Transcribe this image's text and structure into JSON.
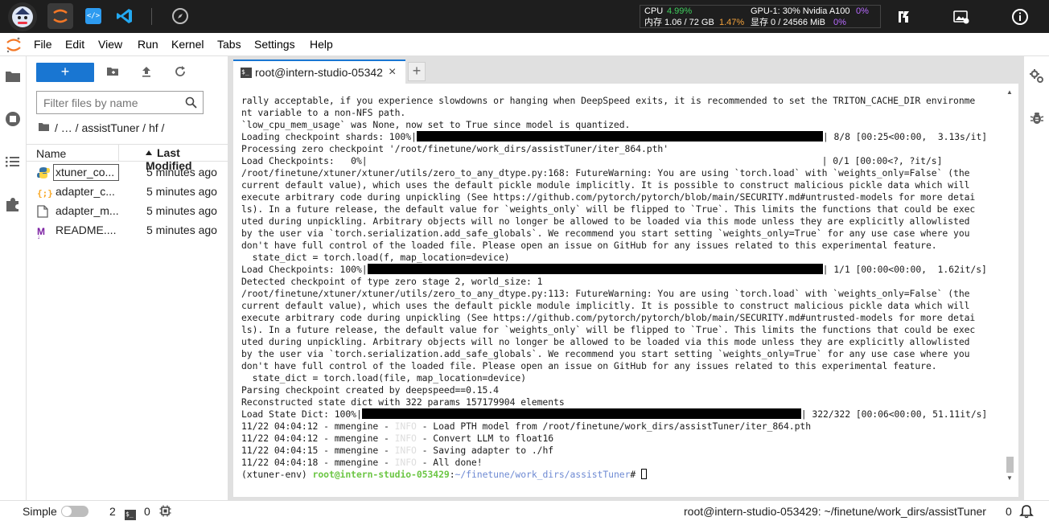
{
  "topbar": {
    "icons": [
      "avatar-logo",
      "jupyter-icon",
      "code-icon",
      "vscode-icon",
      "compass-icon"
    ],
    "cpu_label": "CPU",
    "cpu_value": "4.99%",
    "mem_label": "内存 1.06 / 72 GB",
    "mem_value": "1.47%",
    "gpu_label": "GPU-1: 30% Nvidia A100",
    "gpu_value": "0%",
    "vram_label": "显存 0 / 24566 MiB",
    "vram_value": "0%",
    "right_icons": [
      "transfer-icon",
      "image-settings-icon",
      "info-icon"
    ],
    "colors": {
      "green": "#3fce5d",
      "orange": "#f3a23c",
      "purple": "#b86bff"
    }
  },
  "menu": {
    "items": [
      "File",
      "Edit",
      "View",
      "Run",
      "Kernel",
      "Tabs",
      "Settings",
      "Help"
    ]
  },
  "filebrowser": {
    "new_label": "+",
    "filter_placeholder": "Filter files by name",
    "breadcrumb": "/ … / assistTuner / hf /",
    "col_name": "Name",
    "col_modified": "Last Modified",
    "files": [
      {
        "name": "xtuner_co...",
        "time": "5 minutes ago",
        "icon": "python-icon"
      },
      {
        "name": "adapter_c...",
        "time": "5 minutes ago",
        "icon": "json-icon"
      },
      {
        "name": "adapter_m...",
        "time": "5 minutes ago",
        "icon": "file-icon"
      },
      {
        "name": "README....",
        "time": "5 minutes ago",
        "icon": "markdown-icon"
      }
    ]
  },
  "tab": {
    "label": "root@intern-studio-05342",
    "close": "×",
    "add": "+"
  },
  "terminal": {
    "lines": [
      "rally acceptable, if you experience slowdowns or hanging when DeepSpeed exits, it is recommended to set the TRITON_CACHE_DIR environme",
      "nt variable to a non-NFS path.",
      "`low_cpu_mem_usage` was None, now set to True since model is quantized.",
      "Loading checkpoint shards: 100%|",
      "| 8/8 [00:25<00:00,  3.13s/it]",
      "Processing zero checkpoint '/root/finetune/work_dirs/assistTuner/iter_864.pth'",
      "Load Checkpoints:   0%|                                                                                   | 0/1 [00:00<?, ?it/s]",
      "/root/finetune/xtuner/xtuner/utils/zero_to_any_dtype.py:168: FutureWarning: You are using `torch.load` with `weights_only=False` (the",
      "current default value), which uses the default pickle module implicitly. It is possible to construct malicious pickle data which will",
      "execute arbitrary code during unpickling (See https://github.com/pytorch/pytorch/blob/main/SECURITY.md#untrusted-models for more detai",
      "ls). In a future release, the default value for `weights_only` will be flipped to `True`. This limits the functions that could be exec",
      "uted during unpickling. Arbitrary objects will no longer be allowed to be loaded via this mode unless they are explicitly allowlisted",
      "by the user via `torch.serialization.add_safe_globals`. We recommend you start setting `weights_only=True` for any use case where you",
      "don't have full control of the loaded file. Please open an issue on GitHub for any issues related to this experimental feature.",
      "  state_dict = torch.load(f, map_location=device)",
      "Load Checkpoints: 100%|",
      "| 1/1 [00:00<00:00,  1.62it/s]",
      "Detected checkpoint of type zero stage 2, world_size: 1",
      "/root/finetune/xtuner/xtuner/utils/zero_to_any_dtype.py:113: FutureWarning: You are using `torch.load` with `weights_only=False` (the",
      "current default value), which uses the default pickle module implicitly. It is possible to construct malicious pickle data which will",
      "execute arbitrary code during unpickling (See https://github.com/pytorch/pytorch/blob/main/SECURITY.md#untrusted-models for more detai",
      "ls). In a future release, the default value for `weights_only` will be flipped to `True`. This limits the functions that could be exec",
      "uted during unpickling. Arbitrary objects will no longer be allowed to be loaded via this mode unless they are explicitly allowlisted",
      "by the user via `torch.serialization.add_safe_globals`. We recommend you start setting `weights_only=True` for any use case where you",
      "don't have full control of the loaded file. Please open an issue on GitHub for any issues related to this experimental feature.",
      "  state_dict = torch.load(file, map_location=device)",
      "Parsing checkpoint created by deepspeed==0.15.4",
      "Reconstructed state dict with 322 params 157179904 elements",
      "Load State Dict: 100%|",
      "| 322/322 [00:06<00:00, 51.11it/s]",
      "11/22 04:04:12 - mmengine - ",
      "INFO",
      " - Load PTH model from /root/finetune/work_dirs/assistTuner/iter_864.pth",
      "11/22 04:04:12 - mmengine - ",
      " - Convert LLM to float16",
      "11/22 04:04:15 - mmengine - ",
      " - Saving adapter to ./hf",
      "11/22 04:04:18 - mmengine - ",
      " - All done!",
      "(xtuner-env) ",
      "root@intern-studio-053429",
      ":",
      "~/finetune/work_dirs/assistTuner",
      "# "
    ]
  },
  "statusbar": {
    "mode": "Simple",
    "terminals": "2",
    "kernels": "0",
    "path": "root@intern-studio-053429: ~/finetune/work_dirs/assistTuner",
    "notifications": "0"
  }
}
